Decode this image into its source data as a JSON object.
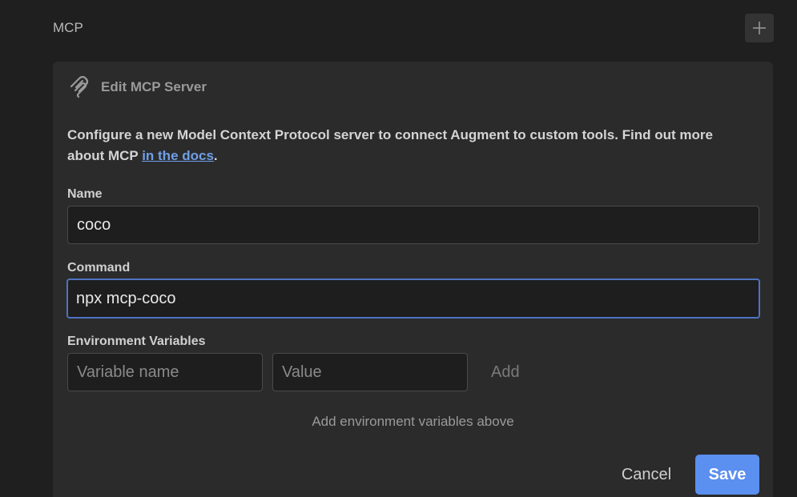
{
  "section": {
    "title": "MCP",
    "add_icon": "plus-icon"
  },
  "card": {
    "title": "Edit MCP Server",
    "icon": "mcp-logo-icon",
    "description_text": "Configure a new Model Context Protocol server to connect Augment to custom tools. Find out more about MCP ",
    "docs_link": "in the docs",
    "description_suffix": "."
  },
  "form": {
    "name_label": "Name",
    "name_value": "coco",
    "command_label": "Command",
    "command_value": "npx mcp-coco",
    "env_label": "Environment Variables",
    "env_name_placeholder": "Variable name",
    "env_value_placeholder": "Value",
    "env_add_label": "Add",
    "env_hint": "Add environment variables above"
  },
  "actions": {
    "cancel_label": "Cancel",
    "save_label": "Save"
  },
  "colors": {
    "background": "#1f1f1f",
    "card": "#2b2b2b",
    "accent": "#5b8ff0",
    "link": "#6f9fe8",
    "focus_border": "#4f72c4"
  }
}
